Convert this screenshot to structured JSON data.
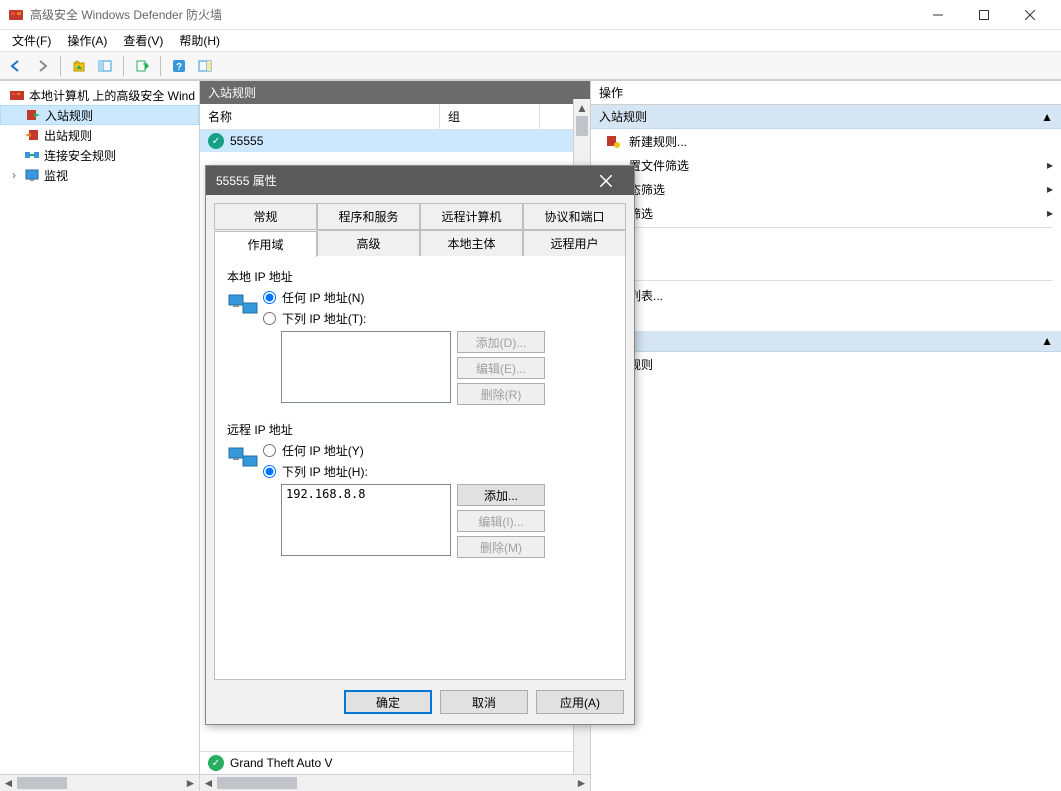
{
  "window": {
    "title": "高级安全 Windows Defender 防火墙"
  },
  "menu": {
    "file": "文件(F)",
    "action": "操作(A)",
    "view": "查看(V)",
    "help": "帮助(H)"
  },
  "tree": {
    "root": "本地计算机 上的高级安全 Wind",
    "inbound": "入站规则",
    "outbound": "出站规则",
    "connection_security": "连接安全规则",
    "monitoring": "监视"
  },
  "center": {
    "header": "入站规则",
    "col_name": "名称",
    "col_group": "组",
    "row1": "55555",
    "row_bottom": "Grand Theft Auto V"
  },
  "actions": {
    "header": "操作",
    "group1": "入站规则",
    "new_rule": "新建规则...",
    "filter_profile": "置文件筛选",
    "filter_state": "态筛选",
    "filter_group": "筛选",
    "list_suffix": "列表...",
    "group2_suffix": "规则"
  },
  "dialog": {
    "title": "55555 属性",
    "tabs_row1": {
      "general": "常规",
      "programs": "程序和服务",
      "remote_computers": "远程计算机",
      "protocols": "协议和端口"
    },
    "tabs_row2": {
      "scope": "作用域",
      "advanced": "高级",
      "local_principals": "本地主体",
      "remote_users": "远程用户"
    },
    "local_ip_label": "本地 IP 地址",
    "any_ip_local": "任何 IP 地址(N)",
    "these_ip_local": "下列 IP 地址(T):",
    "remote_ip_label": "远程 IP 地址",
    "any_ip_remote": "任何 IP 地址(Y)",
    "these_ip_remote": "下列 IP 地址(H):",
    "remote_ip_entry": "192.168.8.8",
    "btn_add_d": "添加(D)...",
    "btn_edit_e": "编辑(E)...",
    "btn_remove_r": "删除(R)",
    "btn_add": "添加...",
    "btn_edit_i": "编辑(I)...",
    "btn_remove_m": "删除(M)",
    "ok": "确定",
    "cancel": "取消",
    "apply": "应用(A)"
  }
}
